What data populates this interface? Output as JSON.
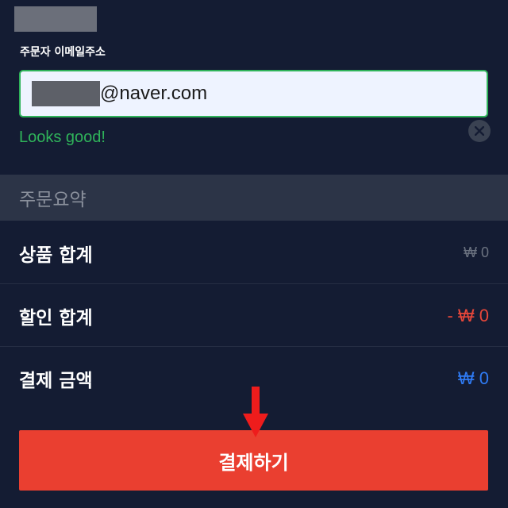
{
  "email": {
    "label": "주문자 이메일주소",
    "domain": "@naver.com",
    "validation_message": "Looks good!"
  },
  "summary": {
    "title": "주문요약",
    "rows": [
      {
        "label": "상품 합계",
        "value": "₩ 0",
        "color": "#6b7280"
      },
      {
        "label": "할인 합계",
        "value": "- ₩ 0",
        "color": "#e8473a"
      },
      {
        "label": "결제 금액",
        "value": "₩ 0",
        "color": "#2f7bf5"
      }
    ]
  },
  "pay_button": {
    "label": "결제하기"
  },
  "colors": {
    "background": "#141c33",
    "valid": "#2fb35a",
    "pay_button": "#ea3f30",
    "arrow": "#ee1c1c"
  },
  "icons": {
    "clear": "close-circle-icon",
    "pointer": "arrow-down-icon"
  }
}
